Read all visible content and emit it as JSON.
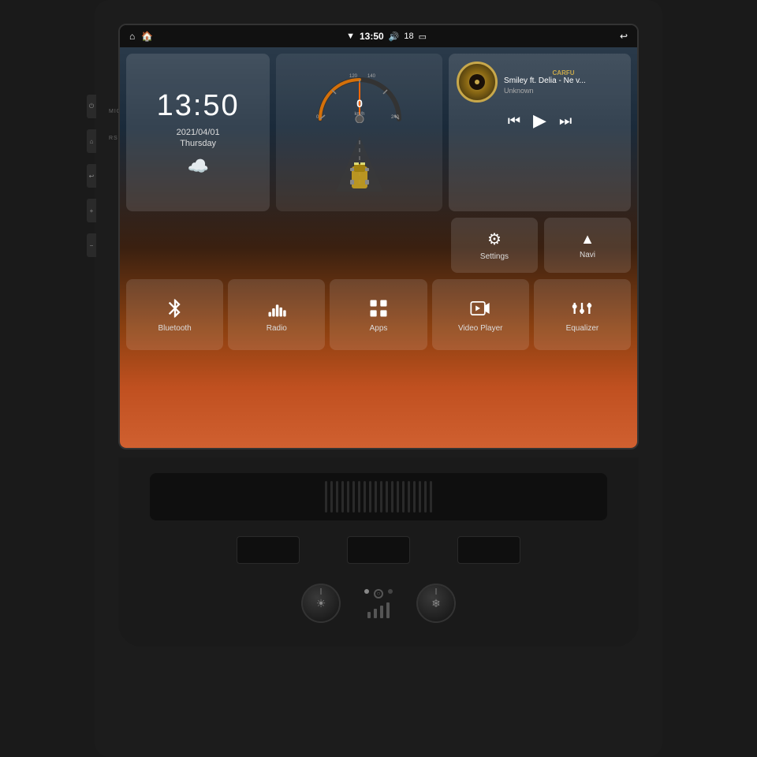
{
  "device": {
    "background_color": "#1c1c1c"
  },
  "statusBar": {
    "time": "13:50",
    "signal_icon": "wifi-icon",
    "volume_icon": "volume-icon",
    "battery_label": "18",
    "nav_icon": "nav-icon",
    "back_icon": "back-icon",
    "home_icon": "home-icon",
    "app_icon": "apps-icon",
    "mic_label": "MIC",
    "rst_label": "RST"
  },
  "clockWidget": {
    "hours": "13",
    "minutes": "50",
    "date": "2021/04/01",
    "day": "Thursday",
    "weather_icon": "☁️"
  },
  "speedWidget": {
    "speed_value": "0",
    "speed_unit": "km/h",
    "max_speed": "240"
  },
  "musicWidget": {
    "title": "Smiley ft. Delia - Ne v...",
    "artist": "Unknown",
    "logo_text": "CARFU",
    "prev_icon": "⏮",
    "play_icon": "▶",
    "next_icon": "⏭"
  },
  "settingsRow": [
    {
      "id": "settings",
      "icon": "⚙",
      "label": "Settings"
    },
    {
      "id": "navi",
      "icon": "▲",
      "label": "Navi"
    }
  ],
  "appRow": [
    {
      "id": "bluetooth",
      "icon": "bluetooth",
      "label": "Bluetooth"
    },
    {
      "id": "radio",
      "icon": "radio",
      "label": "Radio"
    },
    {
      "id": "apps",
      "icon": "apps",
      "label": "Apps"
    },
    {
      "id": "videoplayer",
      "icon": "video",
      "label": "Video Player"
    },
    {
      "id": "equalizer",
      "icon": "eq",
      "label": "Equalizer"
    }
  ],
  "colors": {
    "accent": "#c8a84b",
    "screen_bg_top": "#2a3a4a",
    "screen_bg_bottom": "#c05020",
    "widget_bg": "rgba(255,255,255,0.12)"
  }
}
